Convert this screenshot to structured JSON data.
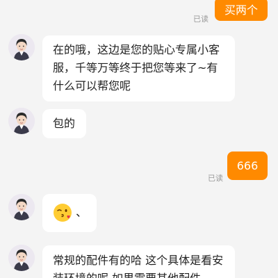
{
  "chat": {
    "messages": [
      {
        "from": "user",
        "text": "买两个",
        "status": "已读"
      },
      {
        "from": "agent",
        "text": "在的哦，这边是您的贴心专属小客服，千等万等终于把您等来了~有什么可以帮您呢"
      },
      {
        "from": "agent",
        "text": "包的"
      },
      {
        "from": "user",
        "text": "666",
        "status": "已读"
      },
      {
        "from": "agent",
        "emoji": "wink-kiss-face-emoji",
        "text": "、"
      },
      {
        "from": "agent",
        "text": "常规的配件有的哈 这个具体是看安装环境的呢 如果需要其他配件"
      }
    ]
  },
  "colors": {
    "background": "#f4f4f4",
    "outgoing_bubble": "#ff8a00",
    "incoming_bubble": "#ffffff",
    "read_status": "#9a9a9a"
  }
}
